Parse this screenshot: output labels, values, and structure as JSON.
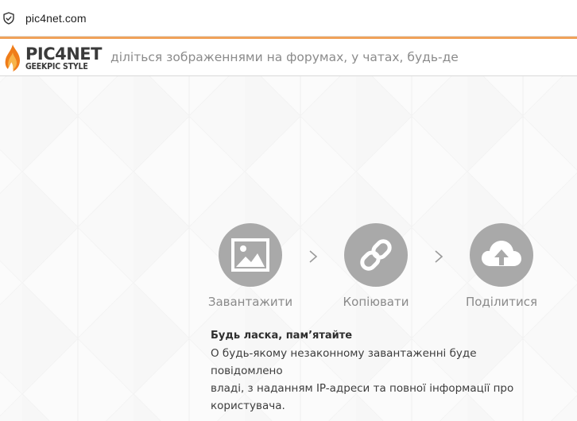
{
  "browser": {
    "url": "pic4net.com",
    "icons": {
      "site_info": "shield-check-icon"
    }
  },
  "header": {
    "logo": {
      "brand": "PIC4NET",
      "subtitle": "GEEKPIC STYLE"
    },
    "tagline": "діліться зображеннями на форумах, у чатах, будь-де"
  },
  "steps": [
    {
      "label": "Завантажити",
      "icon": "image-icon"
    },
    {
      "label": "Копіювати",
      "icon": "link-icon"
    },
    {
      "label": "Поділитися",
      "icon": "cloud-upload-icon"
    }
  ],
  "notice": {
    "title": "Будь ласка, пам’ятайте",
    "lines": [
      "О будь-якому незаконному завантаженні буде повідомлено",
      "владі, з наданням IP-адреси та повної інформації про",
      "користувача."
    ]
  },
  "colors": {
    "accent": "#f0a25a",
    "circle": "#a9a9a9",
    "logo_flame": "#ef7d1a"
  }
}
